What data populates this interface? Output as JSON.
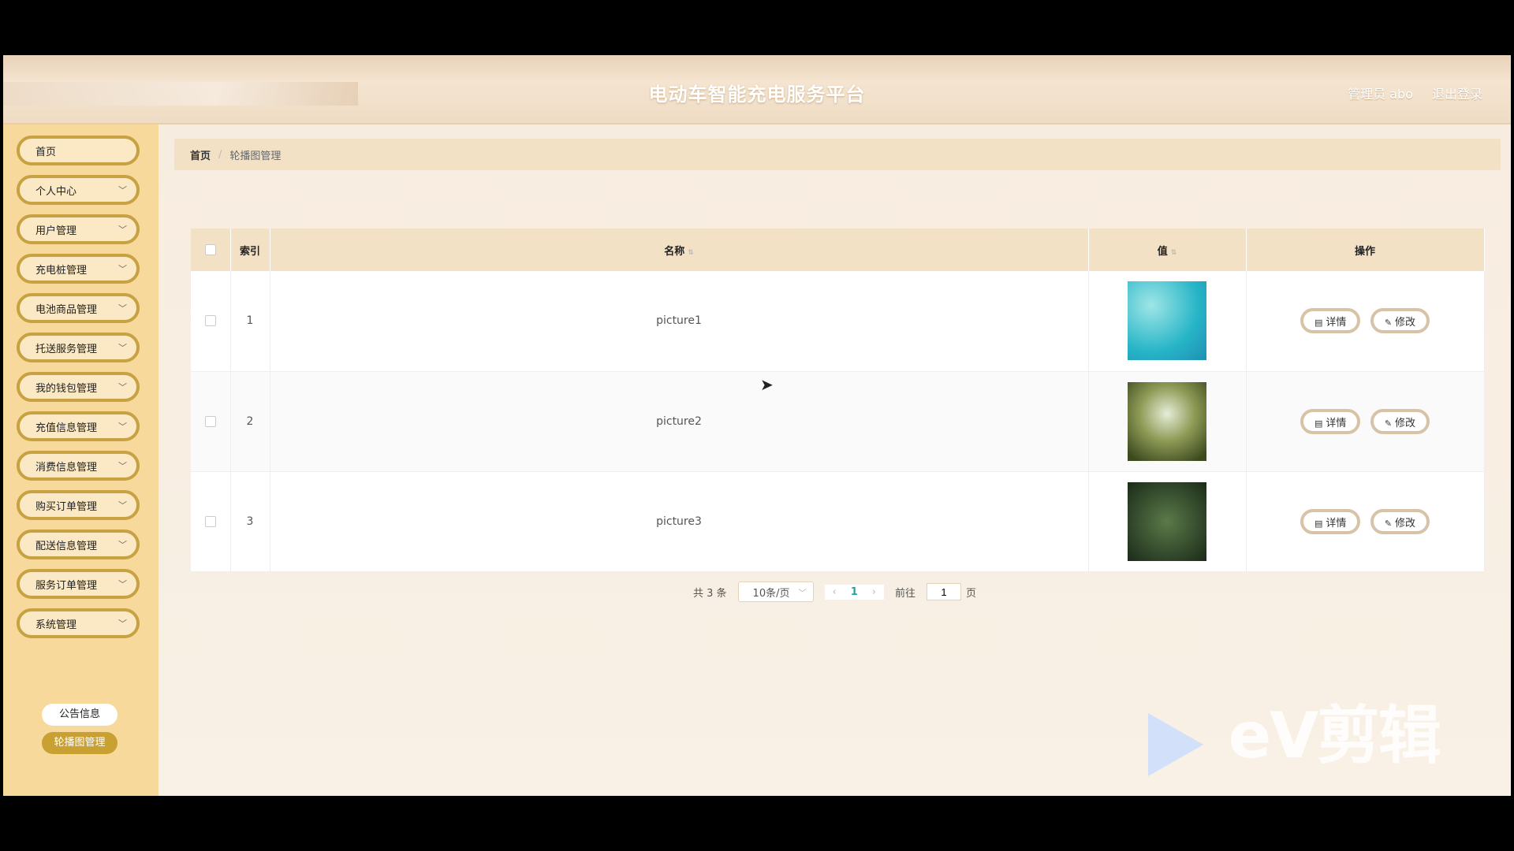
{
  "header": {
    "title": "电动车智能充电服务平台",
    "user": "管理员 abo",
    "logout": "退出登录"
  },
  "sidebar": {
    "items": [
      {
        "label": "首页",
        "chevron": false
      },
      {
        "label": "个人中心",
        "chevron": true
      },
      {
        "label": "用户管理",
        "chevron": true
      },
      {
        "label": "充电桩管理",
        "chevron": true
      },
      {
        "label": "电池商品管理",
        "chevron": true
      },
      {
        "label": "托送服务管理",
        "chevron": true
      },
      {
        "label": "我的钱包管理",
        "chevron": true
      },
      {
        "label": "充值信息管理",
        "chevron": true
      },
      {
        "label": "消费信息管理",
        "chevron": true
      },
      {
        "label": "购买订单管理",
        "chevron": true
      },
      {
        "label": "配送信息管理",
        "chevron": true
      },
      {
        "label": "服务订单管理",
        "chevron": true
      },
      {
        "label": "系统管理",
        "chevron": true
      }
    ],
    "submenu": [
      {
        "label": "公告信息",
        "active": false
      },
      {
        "label": "轮播图管理",
        "active": true
      }
    ]
  },
  "breadcrumb": {
    "home": "首页",
    "sep": "/",
    "current": "轮播图管理"
  },
  "table": {
    "headers": {
      "index": "索引",
      "name": "名称",
      "value": "值",
      "action": "操作"
    },
    "rows": [
      {
        "index": "1",
        "name": "picture1"
      },
      {
        "index": "2",
        "name": "picture2"
      },
      {
        "index": "3",
        "name": "picture3"
      }
    ],
    "detail_label": "详情",
    "edit_label": "修改"
  },
  "pagination": {
    "total": "共 3 条",
    "page_size": "10条/页",
    "current_page": "1",
    "goto_prefix": "前往",
    "goto_value": "1",
    "goto_suffix": "页"
  },
  "watermark": "eV剪辑"
}
